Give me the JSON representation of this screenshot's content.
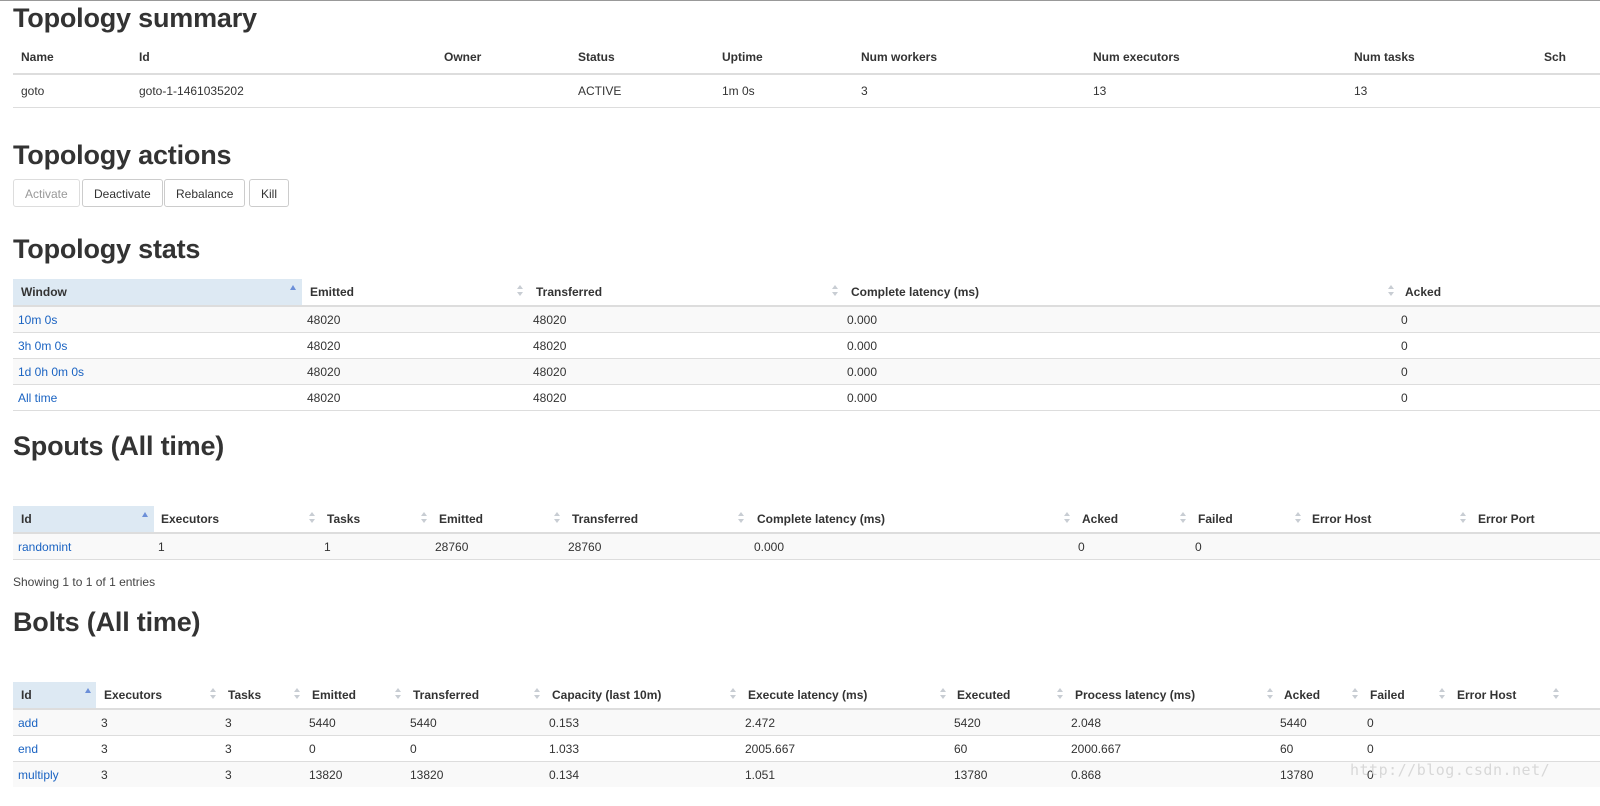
{
  "summary": {
    "title": "Topology summary",
    "headers": [
      "Name",
      "Id",
      "Owner",
      "Status",
      "Uptime",
      "Num workers",
      "Num executors",
      "Num tasks",
      "Sch"
    ],
    "row": [
      "goto",
      "goto-1-1461035202",
      "",
      "ACTIVE",
      "1m 0s",
      "3",
      "13",
      "13",
      ""
    ]
  },
  "actions": {
    "title": "Topology actions",
    "activate": "Activate",
    "deactivate": "Deactivate",
    "rebalance": "Rebalance",
    "kill": "Kill"
  },
  "stats": {
    "title": "Topology stats",
    "headers": [
      "Window",
      "Emitted",
      "Transferred",
      "Complete latency (ms)",
      "Acked"
    ],
    "rows": [
      [
        "10m 0s",
        "48020",
        "48020",
        "0.000",
        "0"
      ],
      [
        "3h 0m 0s",
        "48020",
        "48020",
        "0.000",
        "0"
      ],
      [
        "1d 0h 0m 0s",
        "48020",
        "48020",
        "0.000",
        "0"
      ],
      [
        "All time",
        "48020",
        "48020",
        "0.000",
        "0"
      ]
    ]
  },
  "spouts": {
    "title": "Spouts (All time)",
    "headers": [
      "Id",
      "Executors",
      "Tasks",
      "Emitted",
      "Transferred",
      "Complete latency (ms)",
      "Acked",
      "Failed",
      "Error Host",
      "Error Port"
    ],
    "rows": [
      [
        "randomint",
        "1",
        "1",
        "28760",
        "28760",
        "0.000",
        "0",
        "0",
        "",
        ""
      ]
    ],
    "info": "Showing 1 to 1 of 1 entries"
  },
  "bolts": {
    "title": "Bolts (All time)",
    "headers": [
      "Id",
      "Executors",
      "Tasks",
      "Emitted",
      "Transferred",
      "Capacity (last 10m)",
      "Execute latency (ms)",
      "Executed",
      "Process latency (ms)",
      "Acked",
      "Failed",
      "Error Host"
    ],
    "rows": [
      [
        "add",
        "3",
        "3",
        "5440",
        "5440",
        "0.153",
        "2.472",
        "5420",
        "2.048",
        "5440",
        "0",
        ""
      ],
      [
        "end",
        "3",
        "3",
        "0",
        "0",
        "1.033",
        "2005.667",
        "60",
        "2000.667",
        "60",
        "0",
        ""
      ],
      [
        "multiply",
        "3",
        "3",
        "13820",
        "13820",
        "0.134",
        "1.051",
        "13780",
        "0.868",
        "13780",
        "0",
        ""
      ]
    ]
  },
  "watermark": "http://blog.csdn.net/"
}
